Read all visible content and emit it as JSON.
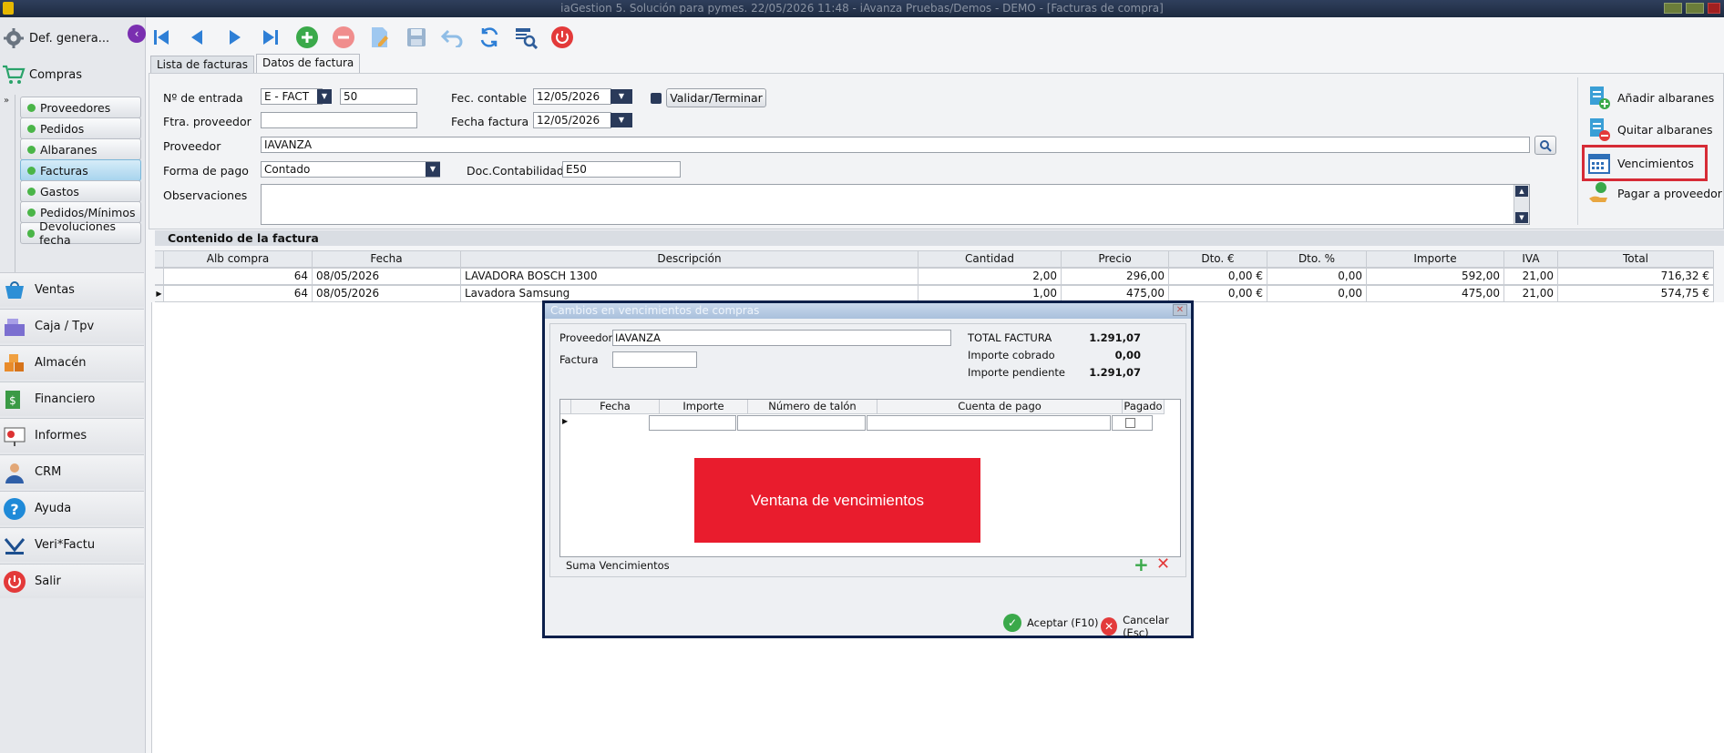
{
  "window": {
    "title": "iaGestion 5. Solución para pymes.   22/05/2026 11:48   -   iAvanza Pruebas/Demos - DEMO - [Facturas de compra]"
  },
  "sidebar": {
    "top_label": "Def. genera...",
    "section_label": "Compras",
    "sub_items": [
      {
        "label": "Proveedores"
      },
      {
        "label": "Pedidos"
      },
      {
        "label": "Albaranes"
      },
      {
        "label": "Facturas"
      },
      {
        "label": "Gastos"
      },
      {
        "label": "Pedidos/Mínimos"
      },
      {
        "label": "Devoluciones fecha"
      }
    ],
    "menu_items": [
      {
        "label": "Ventas"
      },
      {
        "label": "Caja / Tpv"
      },
      {
        "label": "Almacén"
      },
      {
        "label": "Financiero"
      },
      {
        "label": "Informes"
      },
      {
        "label": "CRM"
      },
      {
        "label": "Ayuda"
      },
      {
        "label": "Veri*Factu"
      },
      {
        "label": "Salir"
      }
    ]
  },
  "tabs": [
    {
      "label": "Lista de facturas"
    },
    {
      "label": "Datos de factura"
    }
  ],
  "form": {
    "entrada_label": "Nº de entrada",
    "entrada_serie": "E   - FACT",
    "entrada_num": "50",
    "fec_contable_label": "Fec. contable",
    "fec_contable": "12/05/2026",
    "validar_label": "Validar/Terminar",
    "ftra_proveedor_label": "Ftra. proveedor",
    "ftra_proveedor": "",
    "fecha_factura_label": "Fecha factura",
    "fecha_factura": "12/05/2026",
    "proveedor_label": "Proveedor",
    "proveedor": "IAVANZA",
    "forma_pago_label": "Forma de pago",
    "forma_pago": "Contado",
    "doc_contab_label": "Doc.Contabilidad",
    "doc_contab": "E50",
    "observaciones_label": "Observaciones",
    "observaciones": ""
  },
  "right_actions": [
    {
      "label": "Añadir albaranes"
    },
    {
      "label": "Quitar albaranes"
    },
    {
      "label": "Vencimientos"
    },
    {
      "label": "Pagar a proveedor"
    }
  ],
  "section_title": "Contenido de la factura",
  "table": {
    "headers": [
      "Alb compra",
      "Fecha",
      "Descripción",
      "Cantidad",
      "Precio",
      "Dto. €",
      "Dto. %",
      "Importe",
      "IVA",
      "Total"
    ],
    "rows": [
      [
        "64",
        "08/05/2026",
        "LAVADORA BOSCH 1300",
        "2,00",
        "296,00",
        "0,00 €",
        "0,00",
        "592,00",
        "21,00",
        "716,32 €"
      ],
      [
        "64",
        "08/05/2026",
        "Lavadora Samsung",
        "1,00",
        "475,00",
        "0,00 €",
        "0,00",
        "475,00",
        "21,00",
        "574,75 €"
      ]
    ]
  },
  "dialog": {
    "title": "Cambios en vencimientos de compras",
    "proveedor_label": "Proveedor",
    "proveedor": "IAVANZA",
    "factura_label": "Factura",
    "factura": "",
    "total_label": "TOTAL FACTURA",
    "total": "1.291,07",
    "cobrado_label": "Importe cobrado",
    "cobrado": "0,00",
    "pendiente_label": "Importe pendiente",
    "pendiente": "1.291,07",
    "grid_headers": [
      "Fecha",
      "Importe",
      "Número de talón",
      "Cuenta de pago",
      "Pagado"
    ],
    "annotation": "Ventana de vencimientos",
    "suma_label": "Suma Vencimientos",
    "aceptar_label": "Aceptar (F10)",
    "cancelar_label": "Cancelar (Esc)"
  }
}
